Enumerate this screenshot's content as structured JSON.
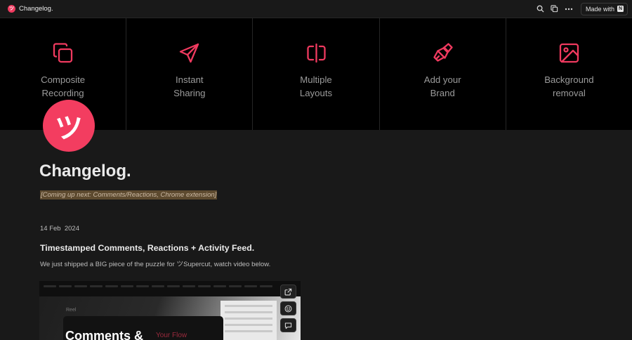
{
  "topbar": {
    "logo_glyph": "ツ",
    "title": "Changelog.",
    "icons": [
      "search-icon",
      "duplicate-icon",
      "more-icon"
    ],
    "made_with_label": "Made with",
    "notion_glyph": "N"
  },
  "features": [
    {
      "icon": "copy-icon",
      "label": "Composite\nRecording"
    },
    {
      "icon": "send-icon",
      "label": "Instant\nSharing"
    },
    {
      "icon": "split-layout-icon",
      "label": "Multiple\nLayouts"
    },
    {
      "icon": "brush-icon",
      "label": "Add your\nBrand"
    },
    {
      "icon": "image-icon",
      "label": "Background\nremoval"
    }
  ],
  "page": {
    "icon_glyph": "ツ",
    "title": "Changelog.",
    "callout": "[Coming up next: Comments/Reactions, Chrome extension]"
  },
  "entry": {
    "date": "14 Feb  2024",
    "heading": "Timestamped Comments, Reactions + Activity Feed.",
    "text": "We just shipped a BIG piece of the puzzle for ツSupercut, watch video below."
  },
  "video": {
    "side_label": "Reel",
    "title": "Comments &",
    "accent": "Your Flow"
  },
  "embed_controls": [
    "open-external-icon",
    "emoji-icon",
    "comment-icon"
  ],
  "colors": {
    "accent": "#f03a5f",
    "background": "#191919",
    "strip_background": "#000000",
    "callout_background": "#5d4a2f"
  }
}
